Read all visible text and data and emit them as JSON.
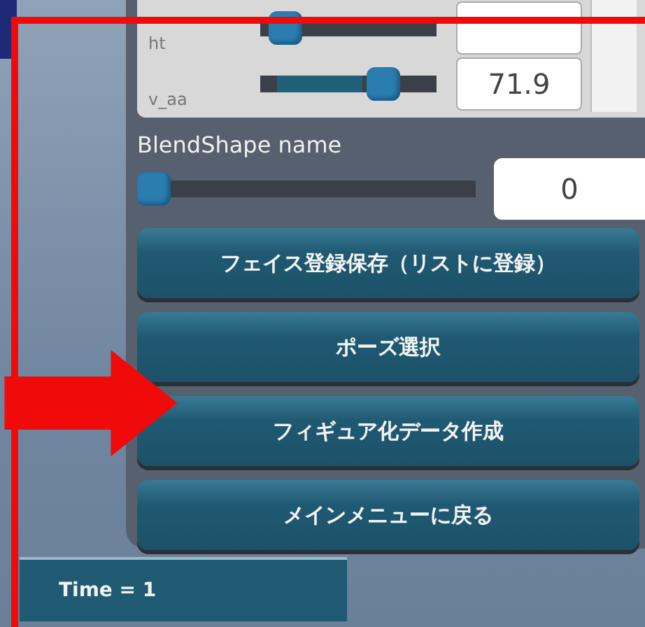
{
  "sliders": [
    {
      "label": "ht",
      "level": 0.05
    },
    {
      "label": "v_aa",
      "level": 0.6,
      "value": "71.9"
    }
  ],
  "blendshape": {
    "label": "BlendShape name",
    "level": 0.0,
    "value": "0"
  },
  "buttons": [
    "フェイス登録保存（リストに登録）",
    "ポーズ選択",
    "フィギュア化データ作成",
    "メインメニューに戻る"
  ],
  "time_label": "Time = 1"
}
